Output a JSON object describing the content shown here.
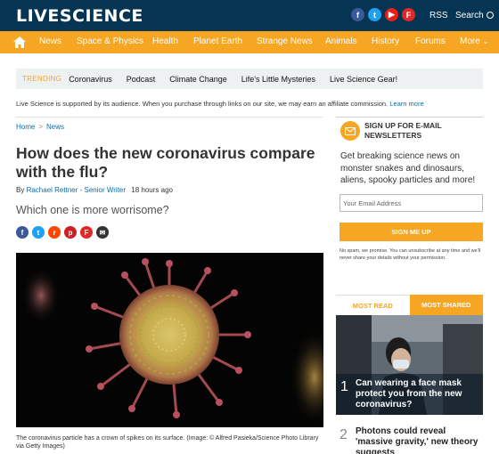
{
  "site": {
    "logo_part1": "LIVE",
    "logo_part2": "SCIENCE",
    "rss": "RSS",
    "search": "Search"
  },
  "social_icons": [
    "facebook-icon",
    "twitter-icon",
    "youtube-icon",
    "flipboard-icon"
  ],
  "nav": {
    "items": [
      "News",
      "Space & Physics",
      "Health",
      "Planet Earth",
      "Strange News",
      "Animals",
      "History",
      "Forums",
      "More"
    ]
  },
  "trending": {
    "label": "TRENDING",
    "items": [
      "Coronavirus",
      "Podcast",
      "Climate Change",
      "Life's Little Mysteries",
      "Live Science Gear!"
    ]
  },
  "affiliate": {
    "text": "Live Science is supported by its audience. When you purchase through links on our site, we may earn an affiliate commission.",
    "link": "Learn more"
  },
  "breadcrumb": [
    "Home",
    "News"
  ],
  "article": {
    "title": "How does the new coronavirus compare with the flu?",
    "by": "By",
    "author": "Rachael Rettner - Senior Writer",
    "time": "18 hours ago",
    "subtitle": "Which one is more worrisome?",
    "caption": "The coronavirus particle has a crown of spikes on its surface. (Image: © Alfred Pasieka/Science Photo Library via Getty Images)"
  },
  "share_icons": [
    "facebook-icon",
    "twitter-icon",
    "reddit-icon",
    "pinterest-icon",
    "flipboard-icon",
    "email-icon"
  ],
  "newsletter": {
    "title": "SIGN UP FOR E-MAIL NEWSLETTERS",
    "text": "Get breaking science news on monster snakes and dinosaurs, aliens, spooky particles and more!",
    "placeholder": "Your Email Address",
    "button": "SIGN ME UP",
    "fine": "No spam, we promise. You can unsubscribe at any time and we'll never share your details without your permission."
  },
  "popular": {
    "tabs": [
      "MOST READ",
      "MOST SHARED"
    ],
    "items": [
      {
        "rank": "1",
        "title": "Can wearing a face mask protect you from the new coronavirus?"
      },
      {
        "rank": "2",
        "title": "Photons could reveal 'massive gravity,' new theory suggests"
      }
    ]
  },
  "colors": {
    "header": "#053552",
    "accent": "#f6a623",
    "link": "#0b6ea8"
  }
}
